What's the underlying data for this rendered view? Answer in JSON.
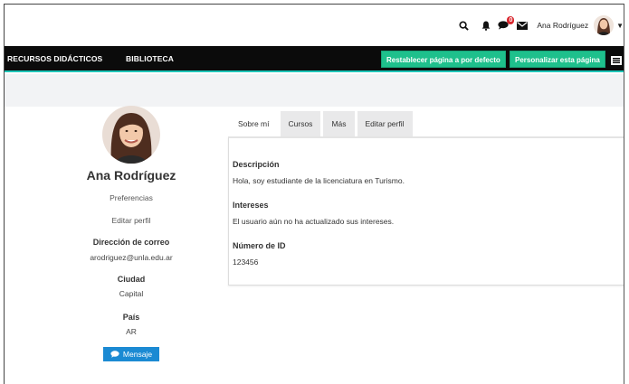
{
  "topbar": {
    "user_name": "Ana Rodríguez",
    "notification_count": "0",
    "icons": [
      "search-icon",
      "bell-icon",
      "chat-icon",
      "envelope-icon",
      "avatar",
      "caret-down-icon"
    ]
  },
  "nav": {
    "items": [
      "RECURSOS DIDÁCTICOS",
      "BIBLIOTECA"
    ],
    "reset_button": "Restablecer página a por defecto",
    "customize_button": "Personalizar esta página",
    "accent_color": "#1ec08c"
  },
  "profile": {
    "name": "Ana Rodríguez",
    "preferences": "Preferencias",
    "edit_profile": "Editar perfil",
    "email_label": "Dirección de correo",
    "email": "arodriguez@unla.edu.ar",
    "city_label": "Ciudad",
    "city": "Capital",
    "country_label": "País",
    "country": "AR",
    "message_button": "Mensaje"
  },
  "tabs": [
    "Sobre mí",
    "Cursos",
    "Más",
    "Editar perfil"
  ],
  "about": {
    "description_label": "Descripción",
    "description": "Hola, soy estudiante de la licenciatura en Turismo.",
    "interests_label": "Intereses",
    "interests": "El usuario aún no ha actualizado sus intereses.",
    "id_label": "Número de ID",
    "id_value": "123456"
  }
}
